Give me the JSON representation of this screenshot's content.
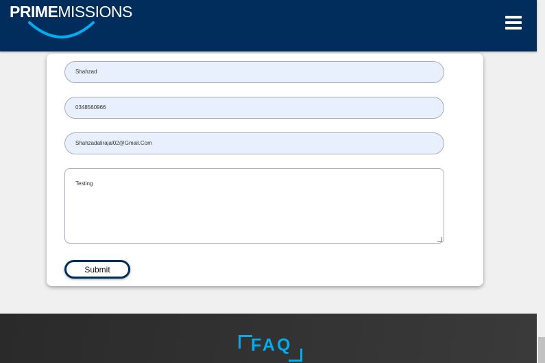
{
  "header": {
    "logo_bold": "PRIME",
    "logo_light": "MISSIONS"
  },
  "form": {
    "name": "Shahzad",
    "phone": "0348560966",
    "email": "Shahzadalirajal02@Gmail.Com",
    "message": "Testing",
    "submit_label": "Submit"
  },
  "footer": {
    "faq_title": "FAQ"
  },
  "colors": {
    "brand": "#002d5c",
    "accent": "#00aeef"
  }
}
